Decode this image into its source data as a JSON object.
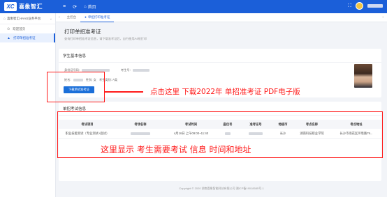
{
  "header": {
    "logo_mark": "XC",
    "logo_text": "喜象智汇",
    "menu_icon": "≡",
    "refresh_icon": "⟳",
    "home_label": "首页",
    "fullscreen_icon": "⛶"
  },
  "sidebar": {
    "platform": "喜象智汇HAAS业务平台",
    "items": [
      {
        "label": "欢迎首页",
        "icon": "⊙"
      },
      {
        "label": "打印单招准考证",
        "icon": "▲"
      }
    ]
  },
  "tabs": [
    {
      "label": "主控台"
    },
    {
      "label": "单招打印准考证"
    }
  ],
  "page": {
    "title": "打印单招准考证",
    "description": "查询打印单招准考证信息，请下载准考证后，自行使用A4纸打印"
  },
  "student": {
    "section_title": "学生基本信息",
    "id_label": "身份证号码:",
    "exam_no_label": "考生号:",
    "name_label": "姓名:",
    "gender_label": "性别:",
    "gender_value": "女",
    "category_label": "考生类别:",
    "category_value": "A类",
    "download_button": "下载单招准考证"
  },
  "exam": {
    "section_title": "单招考试信息",
    "columns": [
      "考试项目",
      "考场名称",
      "考试时间",
      "座位号",
      "准考证号",
      "地级市",
      "考点名称",
      "考点地址"
    ],
    "rows": [
      [
        "职业技能测试（专业测试+面试）",
        "",
        "4月16日 上午09:00~11:40",
        "",
        "",
        "长沙",
        "湖南科技职业学院",
        "长沙市雨花区环境路79..."
      ]
    ]
  },
  "annotations": {
    "download_hint": "点击这里 下载2022年 单招准考证 PDF电子版",
    "table_hint": "这里显示 考生需要考试 信息 时间和地址"
  },
  "footer": {
    "copyright": "Copyright © 2020 湖南喜象智能科技有限公司 湘ICP备19018585号-1"
  },
  "colors": {
    "brand": "#1b5fd9",
    "annotation": "#ff1a1a"
  }
}
